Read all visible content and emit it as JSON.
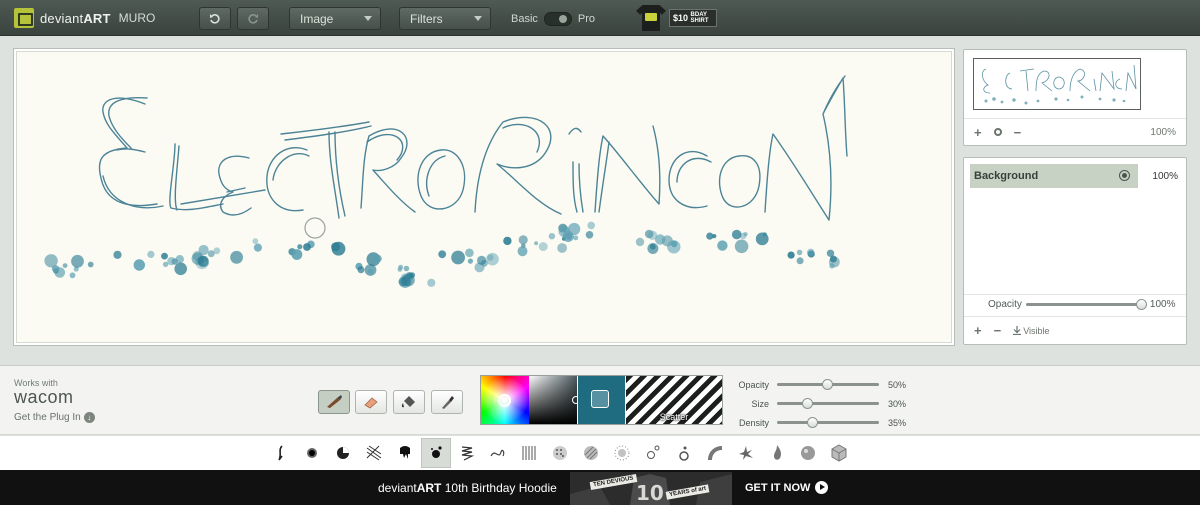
{
  "app": {
    "brand_light": "deviant",
    "brand_bold": "ART",
    "product": "MURO"
  },
  "toolbar": {
    "undo_icon": "undo-icon",
    "redo_icon": "redo-icon",
    "image_menu": "Image",
    "filters_menu": "Filters",
    "mode_basic": "Basic",
    "mode_pro": "Pro",
    "promo": {
      "price": "$10",
      "caption": "BDAY SHIRT"
    }
  },
  "navigator": {
    "zoom_pct": "100%"
  },
  "layers": {
    "items": [
      {
        "name": "Background",
        "opacity_pct": "100%",
        "visible": true
      }
    ],
    "opacity_label": "Opacity",
    "opacity_value": "100%",
    "opacity_level": 1.0,
    "visible_label": "Visible"
  },
  "wacom": {
    "works_with": "Works with",
    "brand": "wacom",
    "plugin_link": "Get the Plug In"
  },
  "tools": [
    {
      "name": "brush",
      "active": true
    },
    {
      "name": "eraser",
      "active": false
    },
    {
      "name": "fill",
      "active": false
    },
    {
      "name": "eyedropper",
      "active": false
    }
  ],
  "color": {
    "current": "#1f6b80",
    "texture_label": "Scatter"
  },
  "brush_settings": {
    "opacity": {
      "label": "Opacity",
      "value": "50%",
      "level": 0.5
    },
    "size": {
      "label": "Size",
      "value": "30%",
      "level": 0.3
    },
    "density": {
      "label": "Density",
      "value": "35%",
      "level": 0.35
    }
  },
  "brushes": [
    "pen-brush",
    "soft-brush",
    "chunky-brush",
    "hatch-brush",
    "drip-brush",
    "scatter-brush",
    "spring-brush",
    "squiggle-brush",
    "lines-brush",
    "dots-brush",
    "stripes-brush",
    "spray-brush",
    "bubbles-brush",
    "rings-brush",
    "fan-brush",
    "splat-brush",
    "flame-brush",
    "ball-brush",
    "cube-brush"
  ],
  "active_brush": 5,
  "banner": {
    "brand_light": "deviant",
    "brand_bold": "ART",
    "headline": "10th Birthday Hoodie",
    "badge1": "TEN DEVIOUS",
    "badge2": "YEARS of art",
    "cta": "GET IT NOW"
  }
}
